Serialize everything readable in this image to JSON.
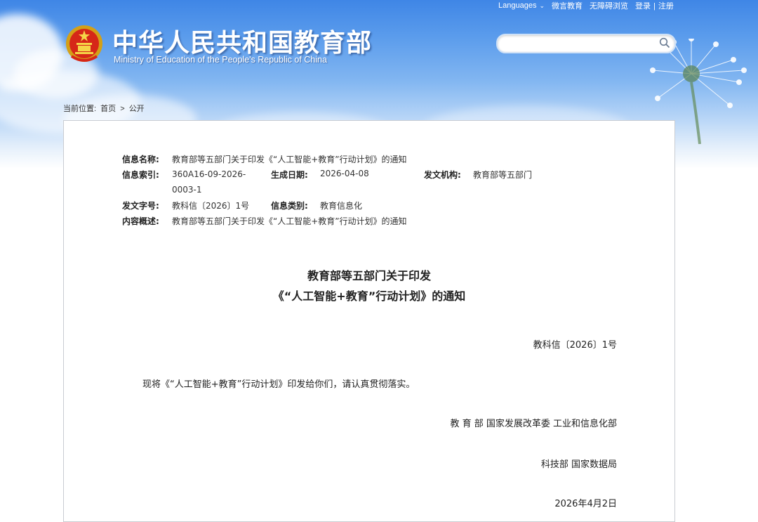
{
  "colors": {
    "header_blue": "#4a8ee8",
    "border": "#c9ccd2",
    "text": "#222222"
  },
  "top_nav": {
    "languages": "Languages",
    "weibo": "微言教育",
    "accessibility": "无障碍浏览",
    "login": "登录",
    "separator": "|",
    "register": "注册"
  },
  "header": {
    "title_cn": "中华人民共和国教育部",
    "title_en": "Ministry of Education of the People's Republic of China",
    "emblem_icon": "national-emblem-icon"
  },
  "search": {
    "placeholder": "",
    "value": "",
    "icon": "search-icon"
  },
  "breadcrumb": {
    "prefix": "当前位置:",
    "home": "首页",
    "separator": ">",
    "current": "公开"
  },
  "meta": {
    "name_label": "信息名称:",
    "name_value": "教育部等五部门关于印发《“人工智能+教育”行动计划》的通知",
    "index_label": "信息索引:",
    "index_value": "360A16-09-2026-0003-1",
    "date_label": "生成日期:",
    "date_value": "2026-04-08",
    "issuer_label": "发文机构:",
    "issuer_value": "教育部等五部门",
    "docno_label": "发文字号:",
    "docno_value": "教科信〔2026〕1号",
    "category_label": "信息类别:",
    "category_value": "教育信息化",
    "summary_label": "内容概述:",
    "summary_value": "教育部等五部门关于印发《“人工智能+教育”行动计划》的通知"
  },
  "document": {
    "title_line1": "教育部等五部门关于印发",
    "title_line2": "《“人工智能+教育”行动计划》的通知",
    "doc_number": "教科信〔2026〕1号",
    "body": "现将《“人工智能+教育”行动计划》印发给你们，请认真贯彻落实。",
    "signatories_line1": "教 育 部   国家发展改革委   工业和信息化部",
    "signatories_line2": "科技部   国家数据局",
    "date": "2026年4月2日"
  }
}
